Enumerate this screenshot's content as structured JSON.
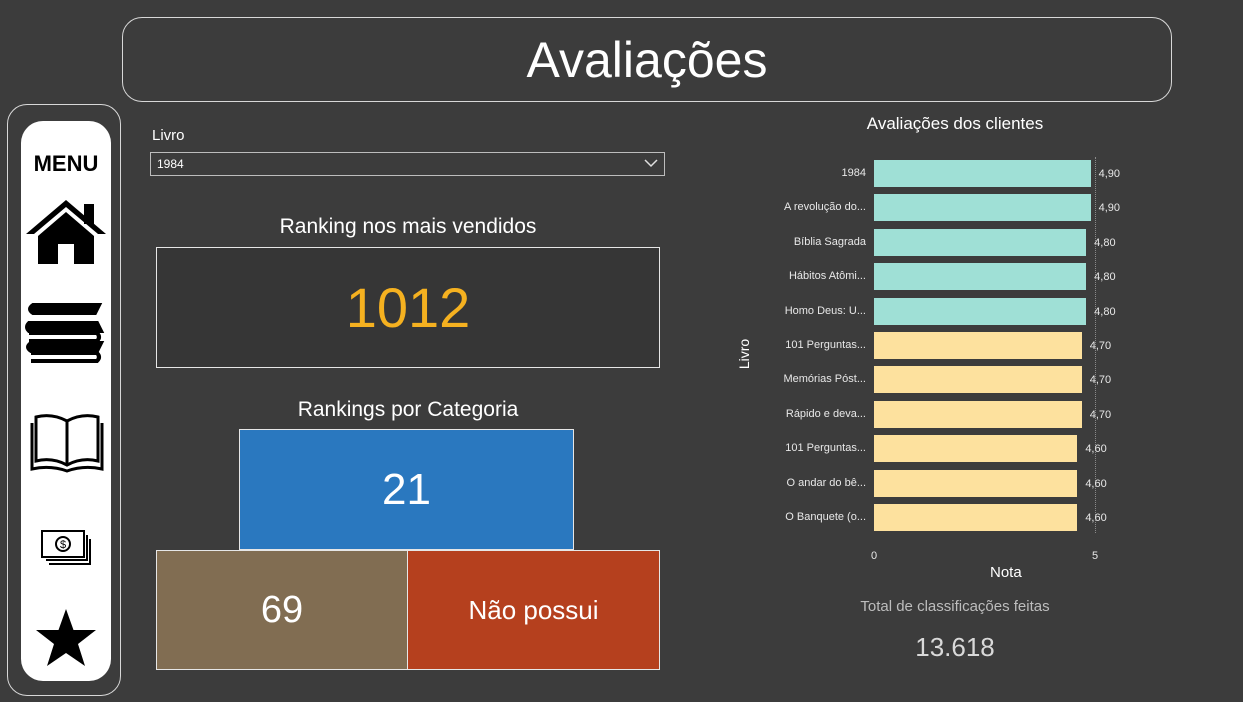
{
  "page": {
    "title": "Avaliações"
  },
  "menu": {
    "label": "MENU",
    "icons": [
      "home-icon",
      "books-stack-icon",
      "open-book-icon",
      "money-icon",
      "star-icon"
    ]
  },
  "filter": {
    "label": "Livro",
    "selected": "1984"
  },
  "ranking": {
    "title": "Ranking nos mais vendidos",
    "value": "1012"
  },
  "categories": {
    "title": "Rankings por Categoria",
    "top_value": "21",
    "bottom_left_value": "69",
    "bottom_right_value": "Não possui"
  },
  "colors": {
    "accent_orange": "#f5b120",
    "tile_blue": "#2a78bf",
    "tile_brown": "#816d52",
    "tile_red": "#b5401e",
    "bar_teal": "#9fe0d6",
    "bar_yellow": "#fde19e"
  },
  "chart_data": {
    "type": "bar",
    "orientation": "horizontal",
    "title": "Avaliações dos clientes",
    "xlabel": "Nota",
    "ylabel": "Livro",
    "xlim": [
      0,
      5
    ],
    "x_ticks": [
      "0",
      "5"
    ],
    "categories": [
      "1984",
      "A revolução do...",
      "Bíblia Sagrada",
      "Hábitos Atômi...",
      "Homo Deus: U...",
      "101 Perguntas...",
      "Memórias Póst...",
      "Rápido e deva...",
      "101 Perguntas...",
      "O andar do bê...",
      "O Banquete (o..."
    ],
    "values": [
      4.9,
      4.9,
      4.8,
      4.8,
      4.8,
      4.7,
      4.7,
      4.7,
      4.6,
      4.6,
      4.6
    ],
    "value_labels": [
      "4,90",
      "4,90",
      "4,80",
      "4,80",
      "4,80",
      "4,70",
      "4,70",
      "4,70",
      "4,60",
      "4,60",
      "4,60"
    ],
    "bar_colors": [
      "#9fe0d6",
      "#9fe0d6",
      "#9fe0d6",
      "#9fe0d6",
      "#9fe0d6",
      "#fde19e",
      "#fde19e",
      "#fde19e",
      "#fde19e",
      "#fde19e",
      "#fde19e"
    ]
  },
  "summary": {
    "label": "Total de classificações feitas",
    "value": "13.618"
  }
}
